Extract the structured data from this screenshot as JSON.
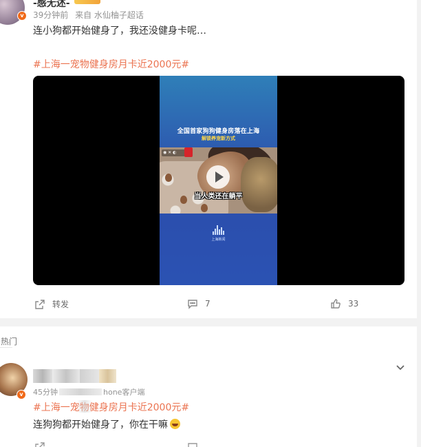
{
  "post": {
    "author_name": "-感无述-",
    "time": "39分钟前",
    "source": "来自 水仙柚子超话",
    "text": "连小狗都开始健身了，我还没健身卡呢…",
    "topic": "#上海一宠物健身房月卡近2000元#",
    "video": {
      "overlay_title": "全国首家狗狗健身房落在上海",
      "overlay_subtitle": "解锁养宠新方式",
      "caption": "当人类还在躺平",
      "logo_text": "上海新闻"
    },
    "actions": {
      "repost_label": "转发",
      "comment_count": "7",
      "like_count": "33"
    }
  },
  "comments": {
    "section_label": "热门",
    "first": {
      "meta_prefix": "45分钟",
      "meta_suffix": "hone客户端",
      "topic": "#上海一宠物健身房月卡近2000元#",
      "text": "连狗狗都开始健身了，你在干嘛"
    }
  },
  "colors": {
    "topic": "#eb7350",
    "vip_badge": "#f06a1a",
    "video_frame": "#2d5bb0"
  }
}
